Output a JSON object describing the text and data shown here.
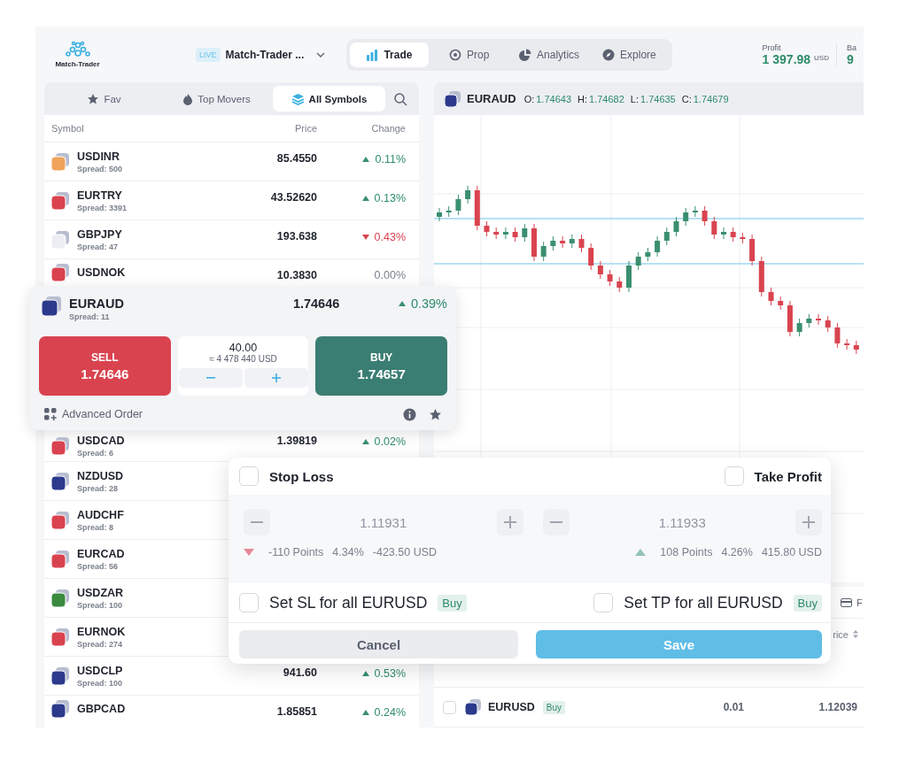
{
  "header": {
    "logo_text": "Match-Trader",
    "account_badge": "LIVE",
    "account_name": "Match-Trader ...",
    "nav_tabs": [
      {
        "label": "Trade",
        "selected": true
      },
      {
        "label": "Prop",
        "selected": false
      },
      {
        "label": "Analytics",
        "selected": false
      },
      {
        "label": "Explore",
        "selected": false
      }
    ],
    "stats": [
      {
        "label": "Profit",
        "value": "1 397.98",
        "unit": "USD"
      },
      {
        "label": "Ba",
        "value": "9"
      }
    ]
  },
  "symbol_panel": {
    "tabs": [
      {
        "label": "Fav",
        "selected": false
      },
      {
        "label": "Top Movers",
        "selected": false
      },
      {
        "label": "All Symbols",
        "selected": true
      }
    ],
    "columns": [
      "Symbol",
      "Price",
      "Change"
    ],
    "rows_above": [
      {
        "symbol": "USDINR",
        "spread": "Spread: 500",
        "price": "85.4550",
        "change": "0.11%",
        "kind": "up",
        "color": "#f0a35a"
      },
      {
        "symbol": "EURTRY",
        "spread": "Spread: 3391",
        "price": "43.52620",
        "change": "0.13%",
        "kind": "up",
        "color": "#d9434f"
      },
      {
        "symbol": "GBPJPY",
        "spread": "Spread: 47",
        "price": "193.638",
        "change": "0.43%",
        "kind": "down",
        "color": "#eceef4"
      },
      {
        "symbol": "USDNOK",
        "price": "10.3830",
        "change": "0.00%",
        "kind": "flat",
        "color": "#d9434f"
      }
    ],
    "trade_card": {
      "symbol": "EURAUD",
      "spread": "Spread: 11",
      "price": "1.74646",
      "change": "0.39%",
      "kind": "up",
      "color": "#2b3a8c",
      "sell": {
        "label": "SELL",
        "price": "1.74646"
      },
      "volume": "40.00",
      "notional": "≈ 4 478 440 USD",
      "buy": {
        "label": "BUY",
        "price": "1.74657"
      },
      "advanced_label": "Advanced Order"
    },
    "rows_below": [
      {
        "symbol": "USDCAD",
        "spread": "Spread: 6",
        "price": "1.39819",
        "change": "0.02%",
        "kind": "up",
        "color": "#d9434f"
      },
      {
        "symbol": "NZDUSD",
        "spread": "Spread: 28",
        "color": "#2b3a8c"
      },
      {
        "symbol": "AUDCHF",
        "spread": "Spread: 8",
        "color": "#d9434f"
      },
      {
        "symbol": "EURCAD",
        "spread": "Spread: 56",
        "color": "#d9434f"
      },
      {
        "symbol": "USDZAR",
        "spread": "Spread: 100",
        "color": "#3a8a3f"
      },
      {
        "symbol": "EURNOK",
        "spread": "Spread: 274",
        "color": "#d9434f"
      },
      {
        "symbol": "USDCLP",
        "spread": "Spread: 100",
        "price": "941.60",
        "change": "0.53%",
        "kind": "up",
        "color": "#2b3a8c"
      },
      {
        "symbol": "GBPCAD",
        "price": "1.85851",
        "change": "0.24%",
        "kind": "up",
        "color": "#2b3a8c"
      }
    ]
  },
  "chart": {
    "symbol": "EURAUD",
    "color": "#2b3a8c",
    "ohlc": [
      {
        "label": "O:",
        "value": "1.74643"
      },
      {
        "label": "H:",
        "value": "1.74682"
      },
      {
        "label": "L:",
        "value": "1.74635"
      },
      {
        "label": "C:",
        "value": "1.74679"
      }
    ]
  },
  "positions": {
    "tab_label": "F",
    "price_header": "rice",
    "rows": [
      {
        "symbol": "EURUSD",
        "side": "Buy",
        "volume": "0.01",
        "price": "1.12039",
        "checked": false,
        "color": "#2b3a8c"
      }
    ]
  },
  "sltp_dialog": {
    "sides": [
      {
        "kind": "loss",
        "label": "Stop Loss",
        "checked": false,
        "placeholder": "1.11931",
        "points": "-110 Points",
        "percent": "4.34%",
        "amount": "-423.50 USD",
        "apply_label": "Set SL for all EURUSD",
        "apply_badge": "Buy",
        "apply_checked": false
      },
      {
        "kind": "profit",
        "label": "Take Profit",
        "checked": false,
        "placeholder": "1.11933",
        "points": "108 Points",
        "percent": "4.26%",
        "amount": "415.80 USD",
        "apply_label": "Set TP for all EURUSD",
        "apply_badge": "Buy",
        "apply_checked": false
      }
    ],
    "cancel_label": "Cancel",
    "save_label": "Save"
  }
}
